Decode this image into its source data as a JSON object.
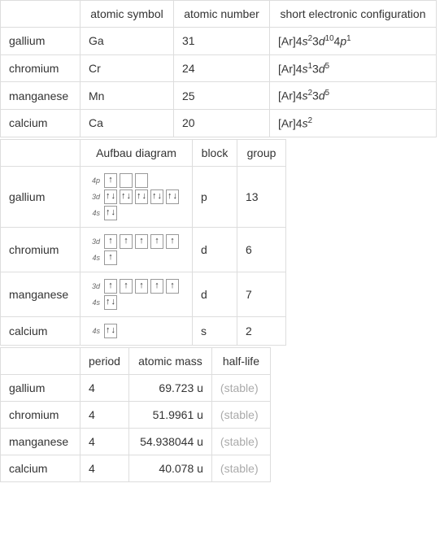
{
  "table1": {
    "headers": [
      "",
      "atomic symbol",
      "atomic number",
      "short electronic configuration"
    ],
    "rows": [
      {
        "name": "gallium",
        "symbol": "Ga",
        "number": "31",
        "config_html": "[Ar]4<span class='italic'>s</span><sup>2</sup>3<span class='italic'>d</span><sup>10</sup>4<span class='italic'>p</span><sup>1</sup>"
      },
      {
        "name": "chromium",
        "symbol": "Cr",
        "number": "24",
        "config_html": "[Ar]4<span class='italic'>s</span><sup>1</sup>3<span class='italic'>d</span><sup>5</sup>"
      },
      {
        "name": "manganese",
        "symbol": "Mn",
        "number": "25",
        "config_html": "[Ar]4<span class='italic'>s</span><sup>2</sup>3<span class='italic'>d</span><sup>5</sup>"
      },
      {
        "name": "calcium",
        "symbol": "Ca",
        "number": "20",
        "config_html": "[Ar]4<span class='italic'>s</span><sup>2</sup>"
      }
    ]
  },
  "table2": {
    "headers": [
      "",
      "Aufbau diagram",
      "block",
      "group"
    ],
    "rows": [
      {
        "name": "gallium",
        "block": "p",
        "group": "13",
        "orbitals": [
          {
            "label": "4p",
            "boxes": [
              [
                "up"
              ],
              [],
              []
            ]
          },
          {
            "label": "3d",
            "boxes": [
              [
                "up",
                "down"
              ],
              [
                "up",
                "down"
              ],
              [
                "up",
                "down"
              ],
              [
                "up",
                "down"
              ],
              [
                "up",
                "down"
              ]
            ]
          },
          {
            "label": "4s",
            "boxes": [
              [
                "up",
                "down"
              ]
            ]
          }
        ]
      },
      {
        "name": "chromium",
        "block": "d",
        "group": "6",
        "orbitals": [
          {
            "label": "3d",
            "boxes": [
              [
                "up"
              ],
              [
                "up"
              ],
              [
                "up"
              ],
              [
                "up"
              ],
              [
                "up"
              ]
            ]
          },
          {
            "label": "4s",
            "boxes": [
              [
                "up"
              ]
            ]
          }
        ]
      },
      {
        "name": "manganese",
        "block": "d",
        "group": "7",
        "orbitals": [
          {
            "label": "3d",
            "boxes": [
              [
                "up"
              ],
              [
                "up"
              ],
              [
                "up"
              ],
              [
                "up"
              ],
              [
                "up"
              ]
            ]
          },
          {
            "label": "4s",
            "boxes": [
              [
                "up",
                "down"
              ]
            ]
          }
        ]
      },
      {
        "name": "calcium",
        "block": "s",
        "group": "2",
        "orbitals": [
          {
            "label": "4s",
            "boxes": [
              [
                "up",
                "down"
              ]
            ]
          }
        ]
      }
    ]
  },
  "table3": {
    "headers": [
      "",
      "period",
      "atomic mass",
      "half-life"
    ],
    "rows": [
      {
        "name": "gallium",
        "period": "4",
        "mass": "69.723 u",
        "halflife": "(stable)"
      },
      {
        "name": "chromium",
        "period": "4",
        "mass": "51.9961 u",
        "halflife": "(stable)"
      },
      {
        "name": "manganese",
        "period": "4",
        "mass": "54.938044 u",
        "halflife": "(stable)"
      },
      {
        "name": "calcium",
        "period": "4",
        "mass": "40.078 u",
        "halflife": "(stable)"
      }
    ]
  }
}
